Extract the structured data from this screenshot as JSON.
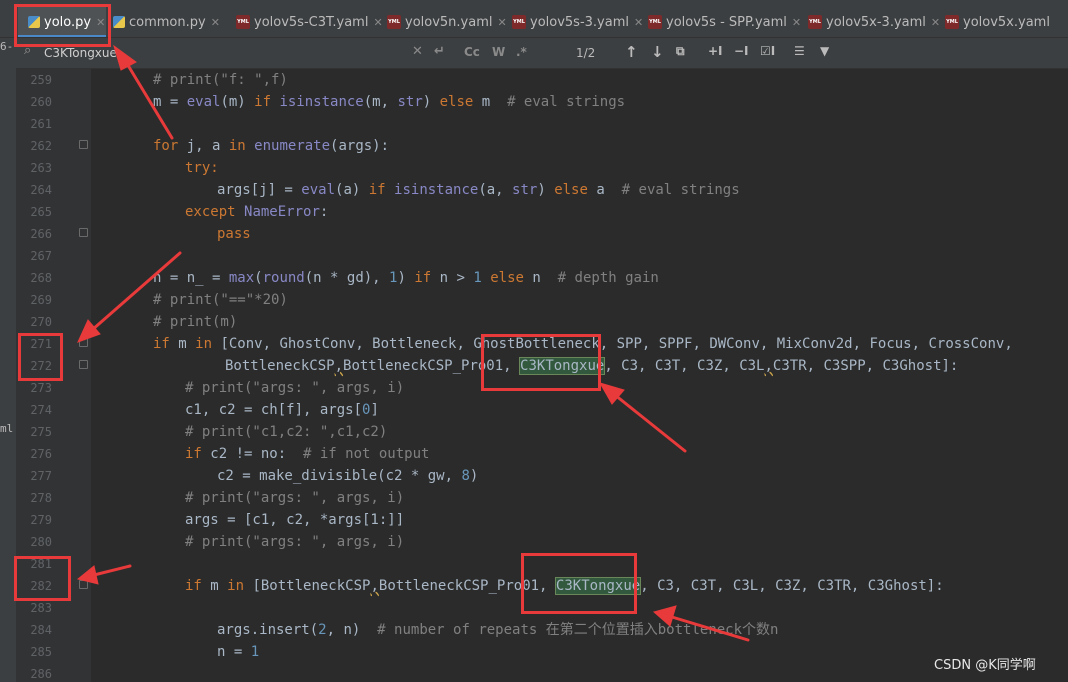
{
  "tabs": [
    {
      "label": "yolo.py",
      "type": "py",
      "active": true
    },
    {
      "label": "common.py",
      "type": "py",
      "active": false
    },
    {
      "label": "yolov5s-C3T.yaml",
      "type": "yaml",
      "active": false
    },
    {
      "label": "yolov5n.yaml",
      "type": "yaml",
      "active": false
    },
    {
      "label": "yolov5s-3.yaml",
      "type": "yaml",
      "active": false
    },
    {
      "label": "yolov5s - SPP.yaml",
      "type": "yaml",
      "active": false
    },
    {
      "label": "yolov5x-3.yaml",
      "type": "yaml",
      "active": false
    },
    {
      "label": "yolov5x.yaml",
      "type": "yaml",
      "active": false
    }
  ],
  "search": {
    "query": "C3KTongxue",
    "match_count": "1/2",
    "options": [
      "Cc",
      "W",
      ".*"
    ]
  },
  "left_strip": {
    "top_fragment": "6-",
    "side_fragment": "ml"
  },
  "line_numbers": [
    "259",
    "260",
    "261",
    "262",
    "263",
    "264",
    "265",
    "266",
    "267",
    "268",
    "269",
    "270",
    "271",
    "272",
    "273",
    "274",
    "275",
    "276",
    "277",
    "278",
    "279",
    "280",
    "281",
    "282",
    "283",
    "284",
    "285",
    "286"
  ],
  "code": {
    "l259": "# print(\"f: \",f)",
    "l260_a": "m = ",
    "l260_b": "eval",
    "l260_c": "(m) ",
    "l260_d": "if ",
    "l260_e": "isinstance",
    "l260_f": "(m, ",
    "l260_g": "str",
    "l260_h": ") ",
    "l260_i": "else ",
    "l260_j": "m  ",
    "l260_k": "# eval strings",
    "l262_a": "for ",
    "l262_b": "j, a ",
    "l262_c": "in ",
    "l262_d": "enumerate",
    "l262_e": "(args):",
    "l263": "try:",
    "l264_a": "args[j] = ",
    "l264_b": "eval",
    "l264_c": "(a) ",
    "l264_d": "if ",
    "l264_e": "isinstance",
    "l264_f": "(a, ",
    "l264_g": "str",
    "l264_h": ") ",
    "l264_i": "else ",
    "l264_j": "a  ",
    "l264_k": "# eval strings",
    "l265_a": "except ",
    "l265_b": "NameError",
    "l265_c": ":",
    "l266": "pass",
    "l268_a": "n = n_ = ",
    "l268_b": "max",
    "l268_c": "(",
    "l268_d": "round",
    "l268_e": "(n * gd), ",
    "l268_f": "1",
    "l268_g": ") ",
    "l268_h": "if ",
    "l268_i": "n > ",
    "l268_j": "1 ",
    "l268_k": "else ",
    "l268_l": "n  ",
    "l268_m": "# depth gain",
    "l269": "# print(\"==\"*20)",
    "l270": "# print(m)",
    "l271_a": "if ",
    "l271_b": "m ",
    "l271_c": "in ",
    "l271_d": "[Conv, GhostConv, Bottleneck, GhostBottleneck, SPP, SPPF, DWConv, MixConv2d, Focus, CrossConv,",
    "l272_a": "BottleneckCSP",
    "l272_b": ",",
    "l272_c": "BottleneckCSP_Pro01, ",
    "l272_d": "C3KTongxue",
    "l272_e": ", C3, C3T, C3Z, C3L",
    "l272_f": ",",
    "l272_g": "C3TR, C3SPP, C3Ghost]:",
    "l273": "# print(\"args: \", args, i)",
    "l274_a": "c1, c2 = ch[f], args[",
    "l274_b": "0",
    "l274_c": "]",
    "l275": "# print(\"c1,c2: \",c1,c2)",
    "l276_a": "if ",
    "l276_b": "c2 != no:  ",
    "l276_c": "# if not output",
    "l277_a": "c2 = make_divisible(c2 * gw, ",
    "l277_b": "8",
    "l277_c": ")",
    "l278": "# print(\"args: \", args, i)",
    "l279": "args = [c1, c2, *args[1:]]",
    "l280": "# print(\"args: \", args, i)",
    "l282_a": "if ",
    "l282_b": "m ",
    "l282_c": "in ",
    "l282_d": "[BottleneckCSP",
    "l282_e": ",",
    "l282_f": "BottleneckCSP_Pro01, ",
    "l282_g": "C3KTongxue",
    "l282_h": ", C3, C3T, C3L, C3Z, C3TR, C3Ghost]:",
    "l284_a": "args.insert(",
    "l284_b": "2",
    "l284_c": ", n)  ",
    "l284_d": "# number of repeats 在第二个位置插入bottleneck个数n",
    "l285_a": "n = ",
    "l285_b": "1"
  },
  "watermark": "CSDN @K同学啊",
  "colors": {
    "keyword": "#cc7832",
    "builtin": "#8888c6",
    "number": "#6897bb",
    "comment": "#808080",
    "annotation": "#e83a3a",
    "match_highlight": "#32593d"
  }
}
